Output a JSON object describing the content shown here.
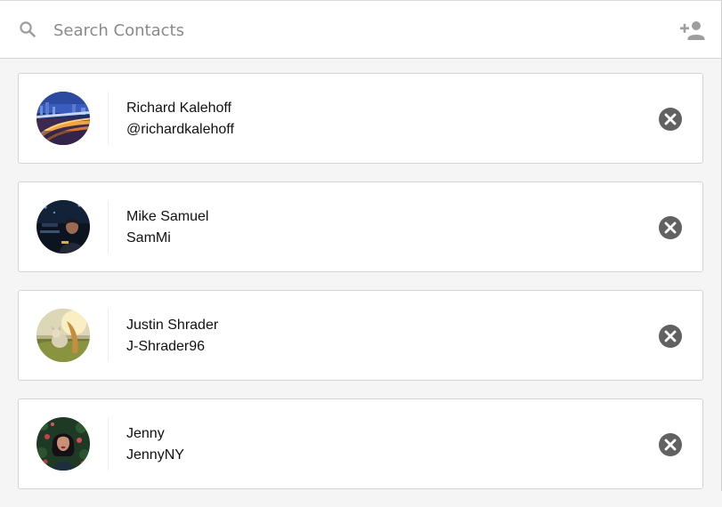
{
  "search": {
    "placeholder": "Search Contacts",
    "value": ""
  },
  "header": {
    "add_contact_icon": "person-add-icon",
    "search_icon": "magnifier-icon"
  },
  "contacts": [
    {
      "name": "Richard Kalehoff",
      "handle": "@richardkalehoff",
      "avatar": "city-bridge-night-photo"
    },
    {
      "name": "Mike Samuel",
      "handle": "SamMi",
      "avatar": "person-night-photo"
    },
    {
      "name": "Justin Shrader",
      "handle": "J-Shrader96",
      "avatar": "dog-sunlight-photo"
    },
    {
      "name": "Jenny",
      "handle": "JennyNY",
      "avatar": "woman-flowers-photo"
    }
  ],
  "colors": {
    "background": "#f5f5f5",
    "card": "#ffffff",
    "icon_grey": "#9e9e9e",
    "remove_button": "#616161"
  }
}
